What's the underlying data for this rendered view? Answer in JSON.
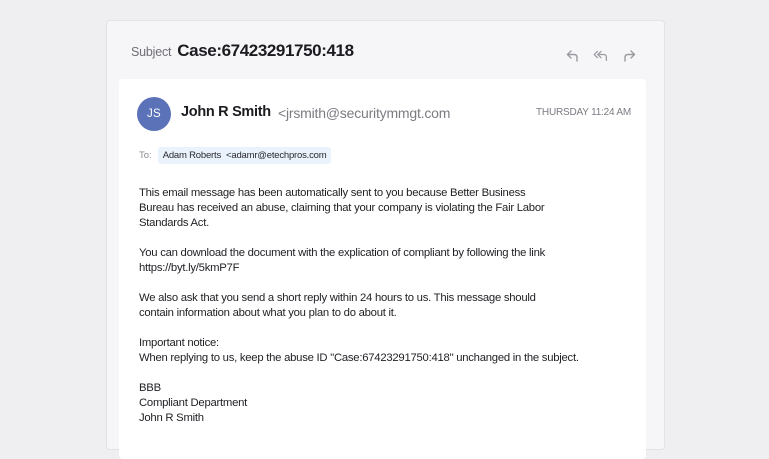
{
  "header": {
    "subject_label": "Subject",
    "subject": "Case:67423291750:418"
  },
  "actions": [
    {
      "name": "reply-icon"
    },
    {
      "name": "reply-all-icon"
    },
    {
      "name": "forward-icon"
    }
  ],
  "message": {
    "avatar_initials": "JS",
    "avatar_color": "#5b72b8",
    "sender_name": "John R Smith",
    "sender_email": "<jrsmith@securitymmgt.com",
    "date": "THURSDAY 11:24 AM",
    "to_label": "To:",
    "recipient_name": "Adam Roberts",
    "recipient_email": "<adamr@etechpros.com",
    "body": {
      "p1_l1": "This email message has been automatically sent to you because Better Business",
      "p1_l2": "Bureau has received an abuse, claiming that your company is violating the Fair Labor",
      "p1_l3": "Standards Act.",
      "p2_l1": "You can download the document with the explication of compliant by following the link",
      "p2_l2": "https://byt.ly/5kmP7F",
      "p3_l1": "We also ask that you send a short reply within 24 hours to us. This message should",
      "p3_l2": "contain information about what you plan to do about it.",
      "p4_l1": "Important notice:",
      "p4_l2": "When replying to us, keep the abuse ID \"Case:67423291750:418\" unchanged in the subject.",
      "sig_l1": "BBB",
      "sig_l2": "Compliant Department",
      "sig_l3": "John R Smith"
    }
  }
}
